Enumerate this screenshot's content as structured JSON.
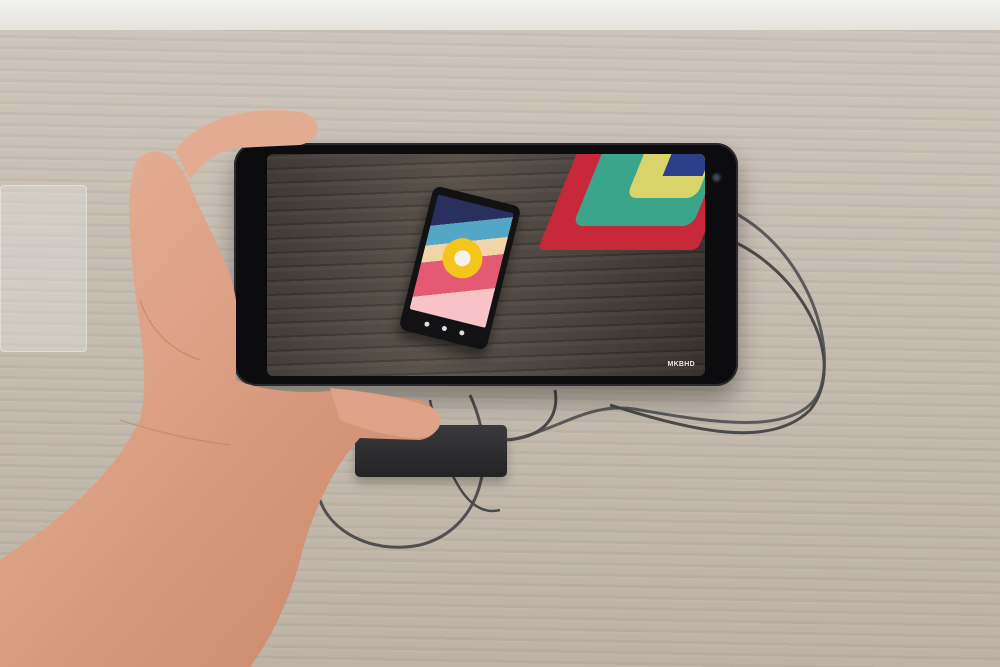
{
  "photo": {
    "watermark": "MKBHD"
  },
  "inner_screen": {
    "nav_icons": [
      "back-icon",
      "home-icon",
      "recents-icon"
    ]
  },
  "colors": {
    "desk": "#c5bcb0",
    "phone_body": "#0c0c0e",
    "towel_red": "#c7283a",
    "towel_green": "#3aa58a",
    "towel_yellow": "#d9d46a",
    "oreo_yellow": "#f4c61b"
  }
}
